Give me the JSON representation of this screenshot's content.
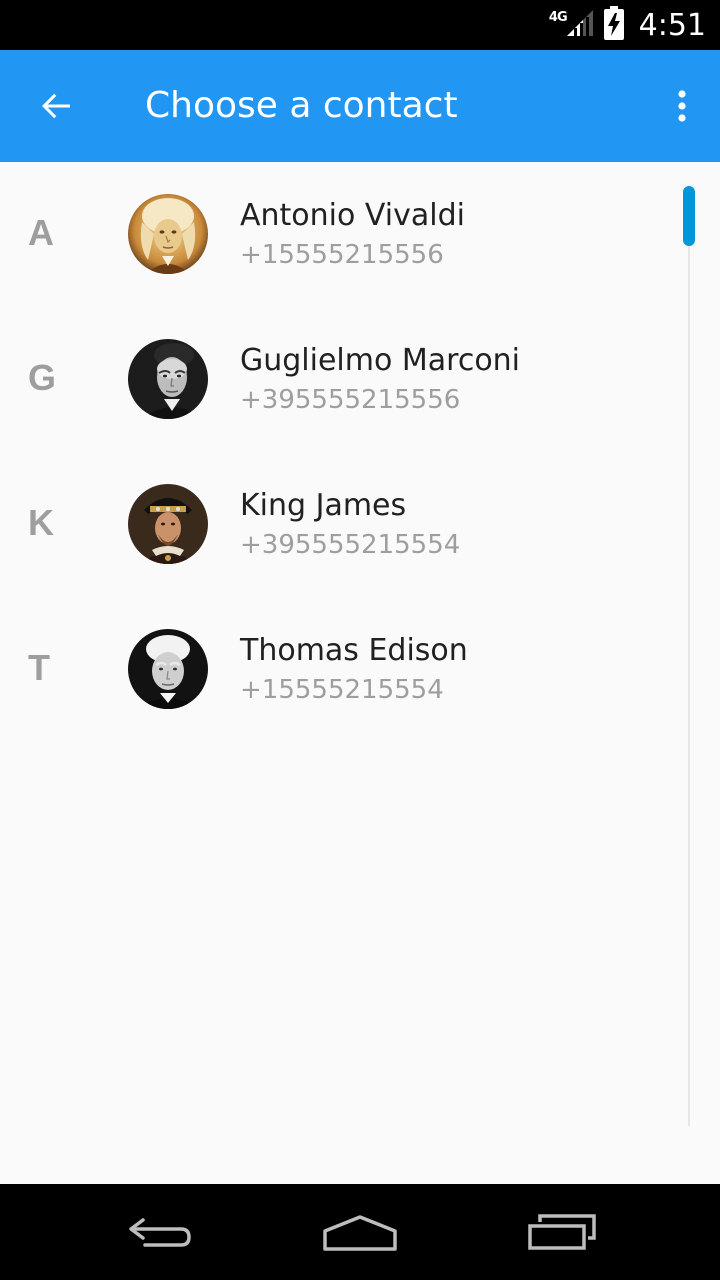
{
  "status_bar": {
    "network_type": "4G",
    "time": "4:51",
    "icons": [
      "signal-icon",
      "battery-charging-icon"
    ]
  },
  "app_bar": {
    "title": "Choose a contact",
    "back_icon": "arrow-back-icon",
    "overflow_icon": "more-vert-icon"
  },
  "contacts": [
    {
      "letter": "A",
      "name": "Antonio Vivaldi",
      "phone": "+15555215556",
      "avatar": "portrait-vivaldi"
    },
    {
      "letter": "G",
      "name": "Guglielmo Marconi",
      "phone": "+395555215556",
      "avatar": "portrait-marconi"
    },
    {
      "letter": "K",
      "name": "King James",
      "phone": "+395555215554",
      "avatar": "portrait-king-james"
    },
    {
      "letter": "T",
      "name": "Thomas Edison",
      "phone": "+15555215554",
      "avatar": "portrait-edison"
    }
  ],
  "colors": {
    "app_bar": "#2196f3",
    "scroll_thumb": "#0097d6",
    "background": "#fafafa",
    "primary_text": "#212121",
    "secondary_text": "#9e9e9e"
  },
  "nav_bar": {
    "icons": [
      "back-nav-icon",
      "home-nav-icon",
      "recents-nav-icon"
    ]
  }
}
